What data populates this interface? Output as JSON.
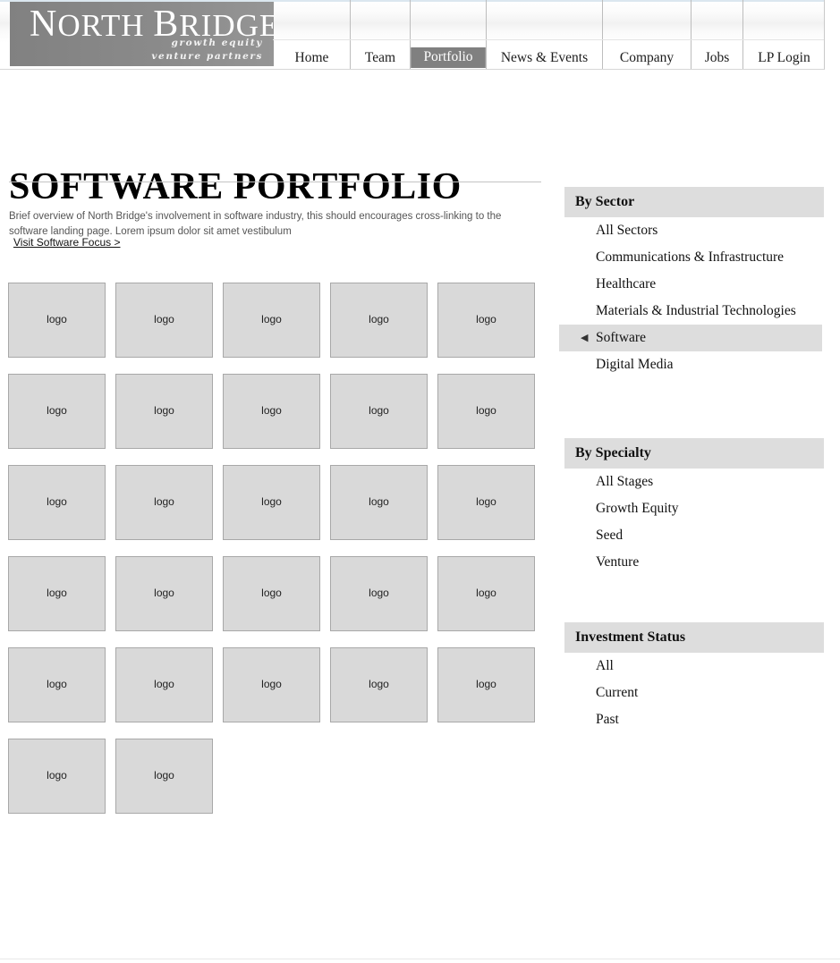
{
  "header": {
    "brand": {
      "name_line1": "North Bridge",
      "tagline_line1": "growth equity",
      "tagline_line2": "venture partners"
    },
    "nav": [
      {
        "label": "Home",
        "active": false
      },
      {
        "label": "Team",
        "active": false
      },
      {
        "label": "Portfolio",
        "active": true
      },
      {
        "label": "News & Events",
        "active": false
      },
      {
        "label": "Company",
        "active": false
      },
      {
        "label": "Jobs",
        "active": false
      },
      {
        "label": "LP Login",
        "active": false
      }
    ]
  },
  "main": {
    "title": "SOFTWARE PORTFOLIO",
    "intro": "Brief overview of North Bridge's involvement in software industry, this should encourages cross-linking to the software landing page. Lorem ipsum dolor sit amet vestibulum",
    "focus_link": "Visit Software Focus >",
    "tile_label": "logo",
    "tile_count": 27,
    "columns": 5
  },
  "sidebar": {
    "facets": [
      {
        "title": "By Sector",
        "items": [
          {
            "label": "All Sectors",
            "selected": false
          },
          {
            "label": "Communications & Infrastructure",
            "selected": false
          },
          {
            "label": "Healthcare",
            "selected": false
          },
          {
            "label": "Materials & Industrial Technologies",
            "selected": false
          },
          {
            "label": "Software",
            "selected": true,
            "marker": "◀"
          },
          {
            "label": "Digital Media",
            "selected": false
          }
        ]
      },
      {
        "title": "By Specialty",
        "items": [
          {
            "label": "All Stages",
            "selected": false
          },
          {
            "label": "Growth Equity",
            "selected": false
          },
          {
            "label": "Seed",
            "selected": false
          },
          {
            "label": "Venture",
            "selected": false
          }
        ]
      },
      {
        "title": "Investment Status",
        "items": [
          {
            "label": "All",
            "selected": false
          },
          {
            "label": "Current",
            "selected": false
          },
          {
            "label": "Past",
            "selected": false
          }
        ]
      }
    ]
  },
  "colors": {
    "brand_gray": "#8a8a8a",
    "facet_header_bg": "#dddddd",
    "tile_bg": "#d9d9d9",
    "tile_border": "#a8a8a8",
    "active_nav_bg": "#808080"
  }
}
